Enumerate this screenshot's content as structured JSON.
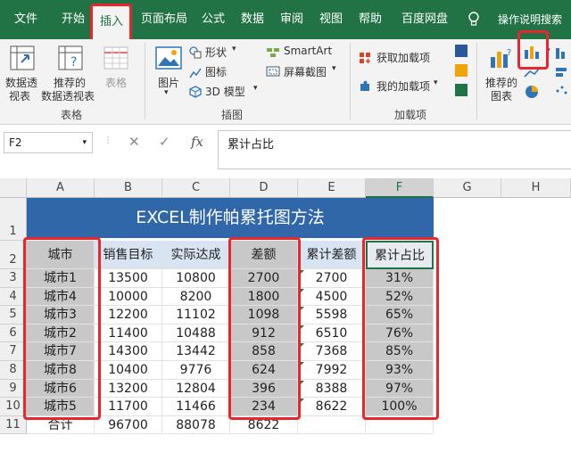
{
  "ribbon_tabs": [
    "文件",
    "开始",
    "插入",
    "页面布局",
    "公式",
    "数据",
    "审阅",
    "视图",
    "帮助",
    "百度网盘"
  ],
  "tell_me": "操作说明搜索",
  "ribbon": {
    "pivot_table": [
      "数据透",
      "视表"
    ],
    "recommended_pivot": [
      "推荐的",
      "数据透视表"
    ],
    "table": "表格",
    "group_tables": "表格",
    "pictures": "图片",
    "shapes": "形状",
    "icons": "图标",
    "model3d": "3D 模型",
    "smartart": "SmartArt",
    "screenshot": "屏幕截图",
    "group_illustrations": "插图",
    "get_addins": "获取加载项",
    "my_addins": "我的加载项",
    "group_addins": "加载项",
    "recommended_charts": [
      "推荐的",
      "图表"
    ]
  },
  "name_box": "F2",
  "formula": "累计占比",
  "columns": [
    "A",
    "B",
    "C",
    "D",
    "E",
    "F",
    "G",
    "H"
  ],
  "rows": [
    "1",
    "2",
    "3",
    "4",
    "5",
    "6",
    "7",
    "8",
    "9",
    "10",
    "11"
  ],
  "title": "EXCEL制作帕累托图方法",
  "headers": [
    "城市",
    "销售目标",
    "实际达成",
    "差额",
    "累计差额",
    "累计占比"
  ],
  "data_rows": [
    [
      "城市1",
      "13500",
      "10800",
      "2700",
      "2700",
      "31%"
    ],
    [
      "城市4",
      "10000",
      "8200",
      "1800",
      "4500",
      "52%"
    ],
    [
      "城市3",
      "12200",
      "11102",
      "1098",
      "5598",
      "65%"
    ],
    [
      "城市2",
      "11400",
      "10488",
      "912",
      "6510",
      "76%"
    ],
    [
      "城市7",
      "14300",
      "13442",
      "858",
      "7368",
      "85%"
    ],
    [
      "城市8",
      "10400",
      "9776",
      "624",
      "7992",
      "93%"
    ],
    [
      "城市6",
      "13200",
      "12804",
      "396",
      "8388",
      "97%"
    ],
    [
      "城市5",
      "11700",
      "11466",
      "234",
      "8622",
      "100%"
    ]
  ],
  "total_row": [
    "合计",
    "96700",
    "88078",
    "8622",
    "",
    ""
  ],
  "colors": {
    "ribbon_green": "#217346",
    "banner_blue": "#3067a8",
    "highlight_red": "#e8262d",
    "header_blue": "#d9e4f2",
    "selection_gray": "#c8c8c8"
  }
}
